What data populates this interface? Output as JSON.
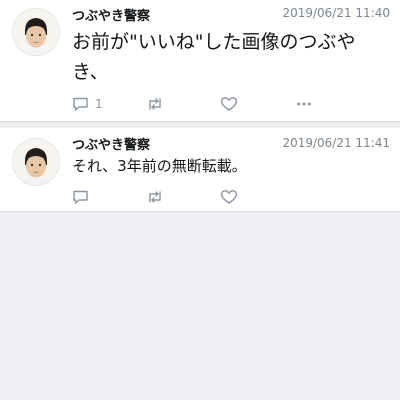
{
  "tweets": [
    {
      "author": "つぶやき警察",
      "timestamp": "2019/06/21 11:40",
      "text": "お前が\"いいね\"した画像のつぶやき、",
      "reply_count": "1",
      "avatar_icon": "user-photo-avatar"
    },
    {
      "author": "つぶやき警察",
      "timestamp": "2019/06/21 11:41",
      "text": "それ、3年前の無断転載。",
      "reply_count": "",
      "avatar_icon": "user-photo-avatar"
    }
  ],
  "icons": {
    "reply": "reply-icon",
    "retweet": "retweet-icon",
    "like": "heart-icon",
    "more": "more-icon"
  },
  "colors": {
    "icon": "#8b96a0",
    "timestamp": "#7d868e",
    "background": "#efeff4"
  }
}
